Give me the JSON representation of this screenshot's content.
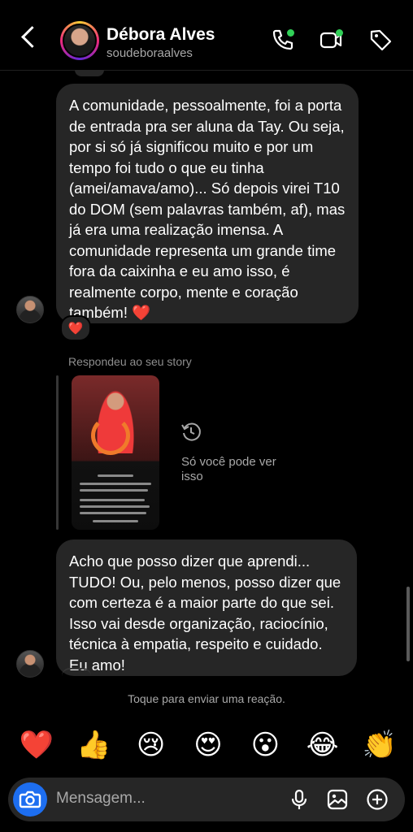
{
  "header": {
    "display_name": "Débora Alves",
    "username": "soudeboraalves"
  },
  "messages": [
    {
      "text": "A comunidade, pessoalmente, foi a porta de entrada pra ser aluna da Tay. Ou seja, por si só já significou muito e por um tempo foi tudo o que eu tinha (amei/amava/amo)... Só depois virei T10 do DOM (sem palavras também, af), mas já era uma realização imensa. A comunidade representa um grande time fora da caixinha e eu amo isso, é realmente corpo, mente e coração também! ❤️",
      "reaction": "❤️"
    },
    {
      "text": "Acho que posso dizer que aprendi... TUDO! Ou, pelo menos, posso dizer que com certeza é a maior parte do que sei. Isso vai desde organização, raciocínio, técnica à empatia, respeito e cuidado. Eu amo!"
    }
  ],
  "story_reply": {
    "label": "Respondeu ao seu story",
    "private_notice": "Só você pode ver isso"
  },
  "reaction_hint": "Toque para enviar uma reação.",
  "quick_reactions": [
    "❤️",
    "👍",
    "😢",
    "😍",
    "😮",
    "😂",
    "👏"
  ],
  "composer": {
    "placeholder": "Mensagem..."
  },
  "colors": {
    "accent_blue": "#1d6ef0",
    "online_green": "#31d158",
    "bubble_gray": "#262626"
  },
  "icons": [
    "back-icon",
    "phone-icon",
    "video-icon",
    "tag-icon",
    "history-icon",
    "camera-icon",
    "microphone-icon",
    "gallery-icon",
    "plus-icon"
  ]
}
